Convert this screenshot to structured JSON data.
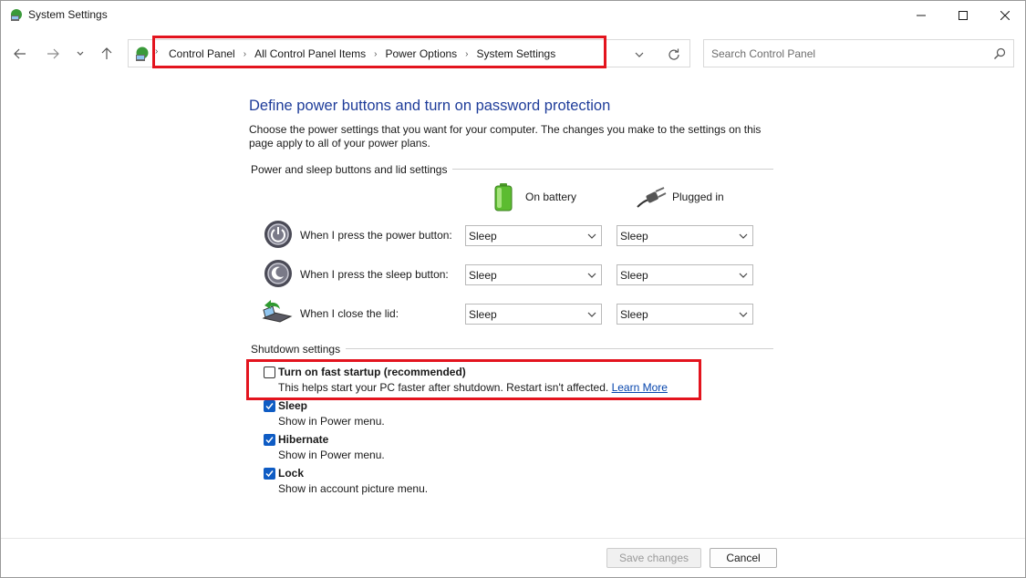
{
  "window": {
    "title": "System Settings"
  },
  "breadcrumb": [
    "Control Panel",
    "All Control Panel Items",
    "Power Options",
    "System Settings"
  ],
  "search": {
    "placeholder": "Search Control Panel",
    "value": ""
  },
  "content": {
    "heading": "Define power buttons and turn on password protection",
    "description": "Choose the power settings that you want for your computer. The changes you make to the settings on this page apply to all of your power plans.",
    "power_group_label": "Power and sleep buttons and lid settings",
    "col_battery": "On battery",
    "col_plugged": "Plugged in",
    "rows": [
      {
        "label": "When I press the power button:",
        "battery": "Sleep",
        "plugged": "Sleep"
      },
      {
        "label": "When I press the sleep button:",
        "battery": "Sleep",
        "plugged": "Sleep"
      },
      {
        "label": "When I close the lid:",
        "battery": "Sleep",
        "plugged": "Sleep"
      }
    ],
    "shutdown_group_label": "Shutdown settings",
    "shutdown_options": [
      {
        "title": "Turn on fast startup (recommended)",
        "desc": "This helps start your PC faster after shutdown. Restart isn't affected.",
        "link": "Learn More",
        "checked": false
      },
      {
        "title": "Sleep",
        "desc": "Show in Power menu.",
        "checked": true
      },
      {
        "title": "Hibernate",
        "desc": "Show in Power menu.",
        "checked": true
      },
      {
        "title": "Lock",
        "desc": "Show in account picture menu.",
        "checked": true
      }
    ]
  },
  "footer": {
    "save_label": "Save changes",
    "cancel_label": "Cancel"
  },
  "colors": {
    "accent": "#0f5cc4",
    "heading": "#1f3d9a",
    "highlight": "#e3141e",
    "link": "#0645ad"
  }
}
